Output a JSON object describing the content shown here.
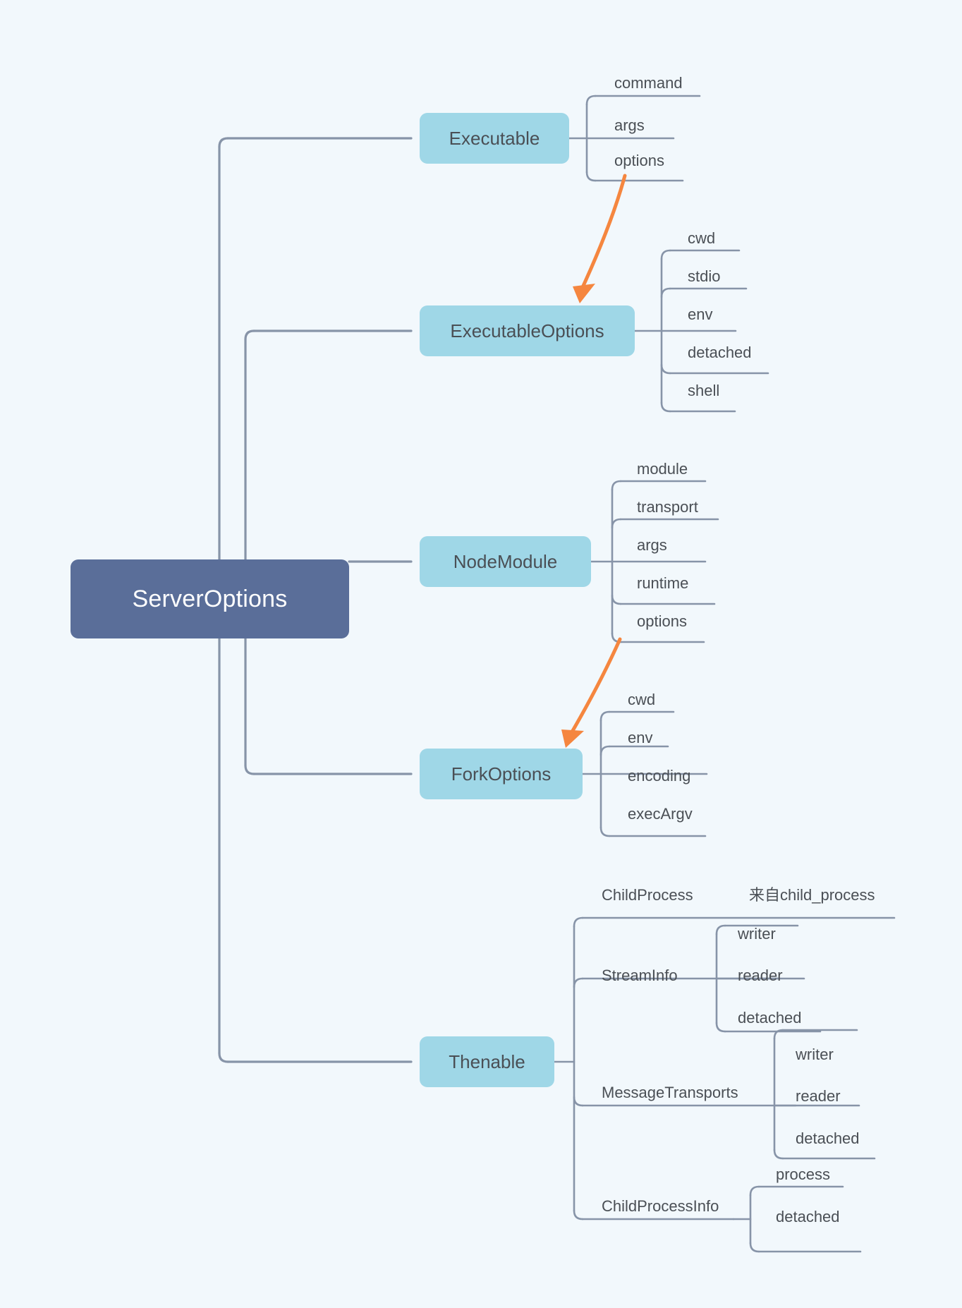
{
  "diagram": {
    "title": "ServerOptions",
    "type": "mindmap",
    "background_color": "#f2f8fc",
    "root_color": "#5a6e99",
    "branch_color": "#9fd7e7",
    "line_color": "#8794a8",
    "accent_arrow_color": "#f5863f",
    "text_color": "#4a4f55"
  },
  "root": {
    "label": "ServerOptions"
  },
  "branches": [
    {
      "id": "executable",
      "label": "Executable",
      "children": [
        {
          "label": "command"
        },
        {
          "label": "args"
        },
        {
          "label": "options"
        }
      ]
    },
    {
      "id": "executable-options",
      "label": "ExecutableOptions",
      "children": [
        {
          "label": "cwd"
        },
        {
          "label": "stdio"
        },
        {
          "label": "env"
        },
        {
          "label": "detached"
        },
        {
          "label": "shell"
        }
      ]
    },
    {
      "id": "node-module",
      "label": "NodeModule",
      "children": [
        {
          "label": "module"
        },
        {
          "label": "transport"
        },
        {
          "label": "args"
        },
        {
          "label": "runtime"
        },
        {
          "label": "options"
        }
      ]
    },
    {
      "id": "fork-options",
      "label": "ForkOptions",
      "children": [
        {
          "label": "cwd"
        },
        {
          "label": "env"
        },
        {
          "label": "encoding"
        },
        {
          "label": "execArgv"
        }
      ]
    },
    {
      "id": "thenable",
      "label": "Thenable",
      "children": [
        {
          "label": "ChildProcess",
          "children": [
            {
              "label": "来自child_process"
            }
          ]
        },
        {
          "label": "StreamInfo",
          "children": [
            {
              "label": "writer"
            },
            {
              "label": "reader"
            },
            {
              "label": "detached"
            }
          ]
        },
        {
          "label": "MessageTransports",
          "children": [
            {
              "label": "writer"
            },
            {
              "label": "reader"
            },
            {
              "label": "detached"
            }
          ]
        },
        {
          "label": "ChildProcessInfo",
          "children": [
            {
              "label": "process"
            },
            {
              "label": "detached"
            }
          ]
        }
      ]
    }
  ],
  "annotations": [
    {
      "id": "arrow-executable-options",
      "from": "Executable.options",
      "to": "ExecutableOptions"
    },
    {
      "id": "arrow-fork-options",
      "from": "NodeModule.options",
      "to": "ForkOptions"
    }
  ]
}
